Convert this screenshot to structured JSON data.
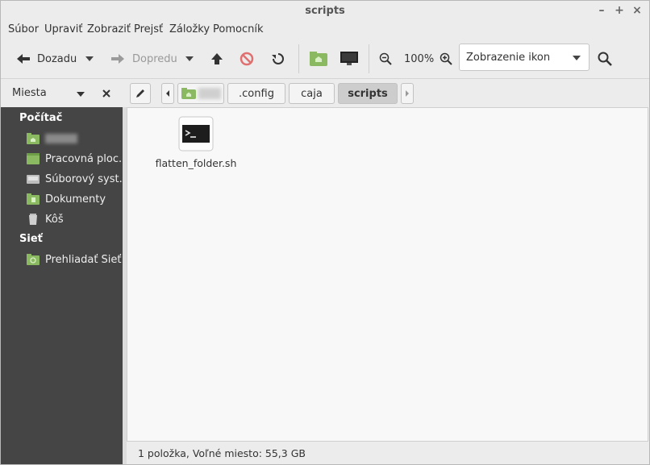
{
  "window": {
    "title": "scripts"
  },
  "menu": [
    "Súbor",
    "Upraviť",
    "Zobraziť",
    "Prejsť",
    "Záložky",
    "Pomocník"
  ],
  "toolbar": {
    "back": "Dozadu",
    "forward": "Dopredu",
    "zoom": "100%",
    "view_mode": "Zobrazenie ikon"
  },
  "location": {
    "places_label": "Miesta",
    "crumbs": [
      ".config",
      "caja",
      "scripts"
    ]
  },
  "sidebar": {
    "section_computer": "Počítač",
    "section_network": "Sieť",
    "items": [
      {
        "label": "",
        "icon": "home-folder-icon"
      },
      {
        "label": "Pracovná ploc...",
        "icon": "desktop-folder-icon"
      },
      {
        "label": "Súborový syst...",
        "icon": "filesystem-icon"
      },
      {
        "label": "Dokumenty",
        "icon": "documents-folder-icon"
      },
      {
        "label": "Kôš",
        "icon": "trash-icon"
      }
    ],
    "network_items": [
      {
        "label": "Prehliadať Sieť",
        "icon": "network-folder-icon"
      }
    ]
  },
  "files": [
    {
      "name": "flatten_folder.sh",
      "icon": "terminal-script-icon"
    }
  ],
  "status": {
    "text": "1 položka, Voľné miesto: 55,3 GB"
  },
  "colors": {
    "accent_green": "#8ab961",
    "sidebar_bg": "#454545"
  }
}
